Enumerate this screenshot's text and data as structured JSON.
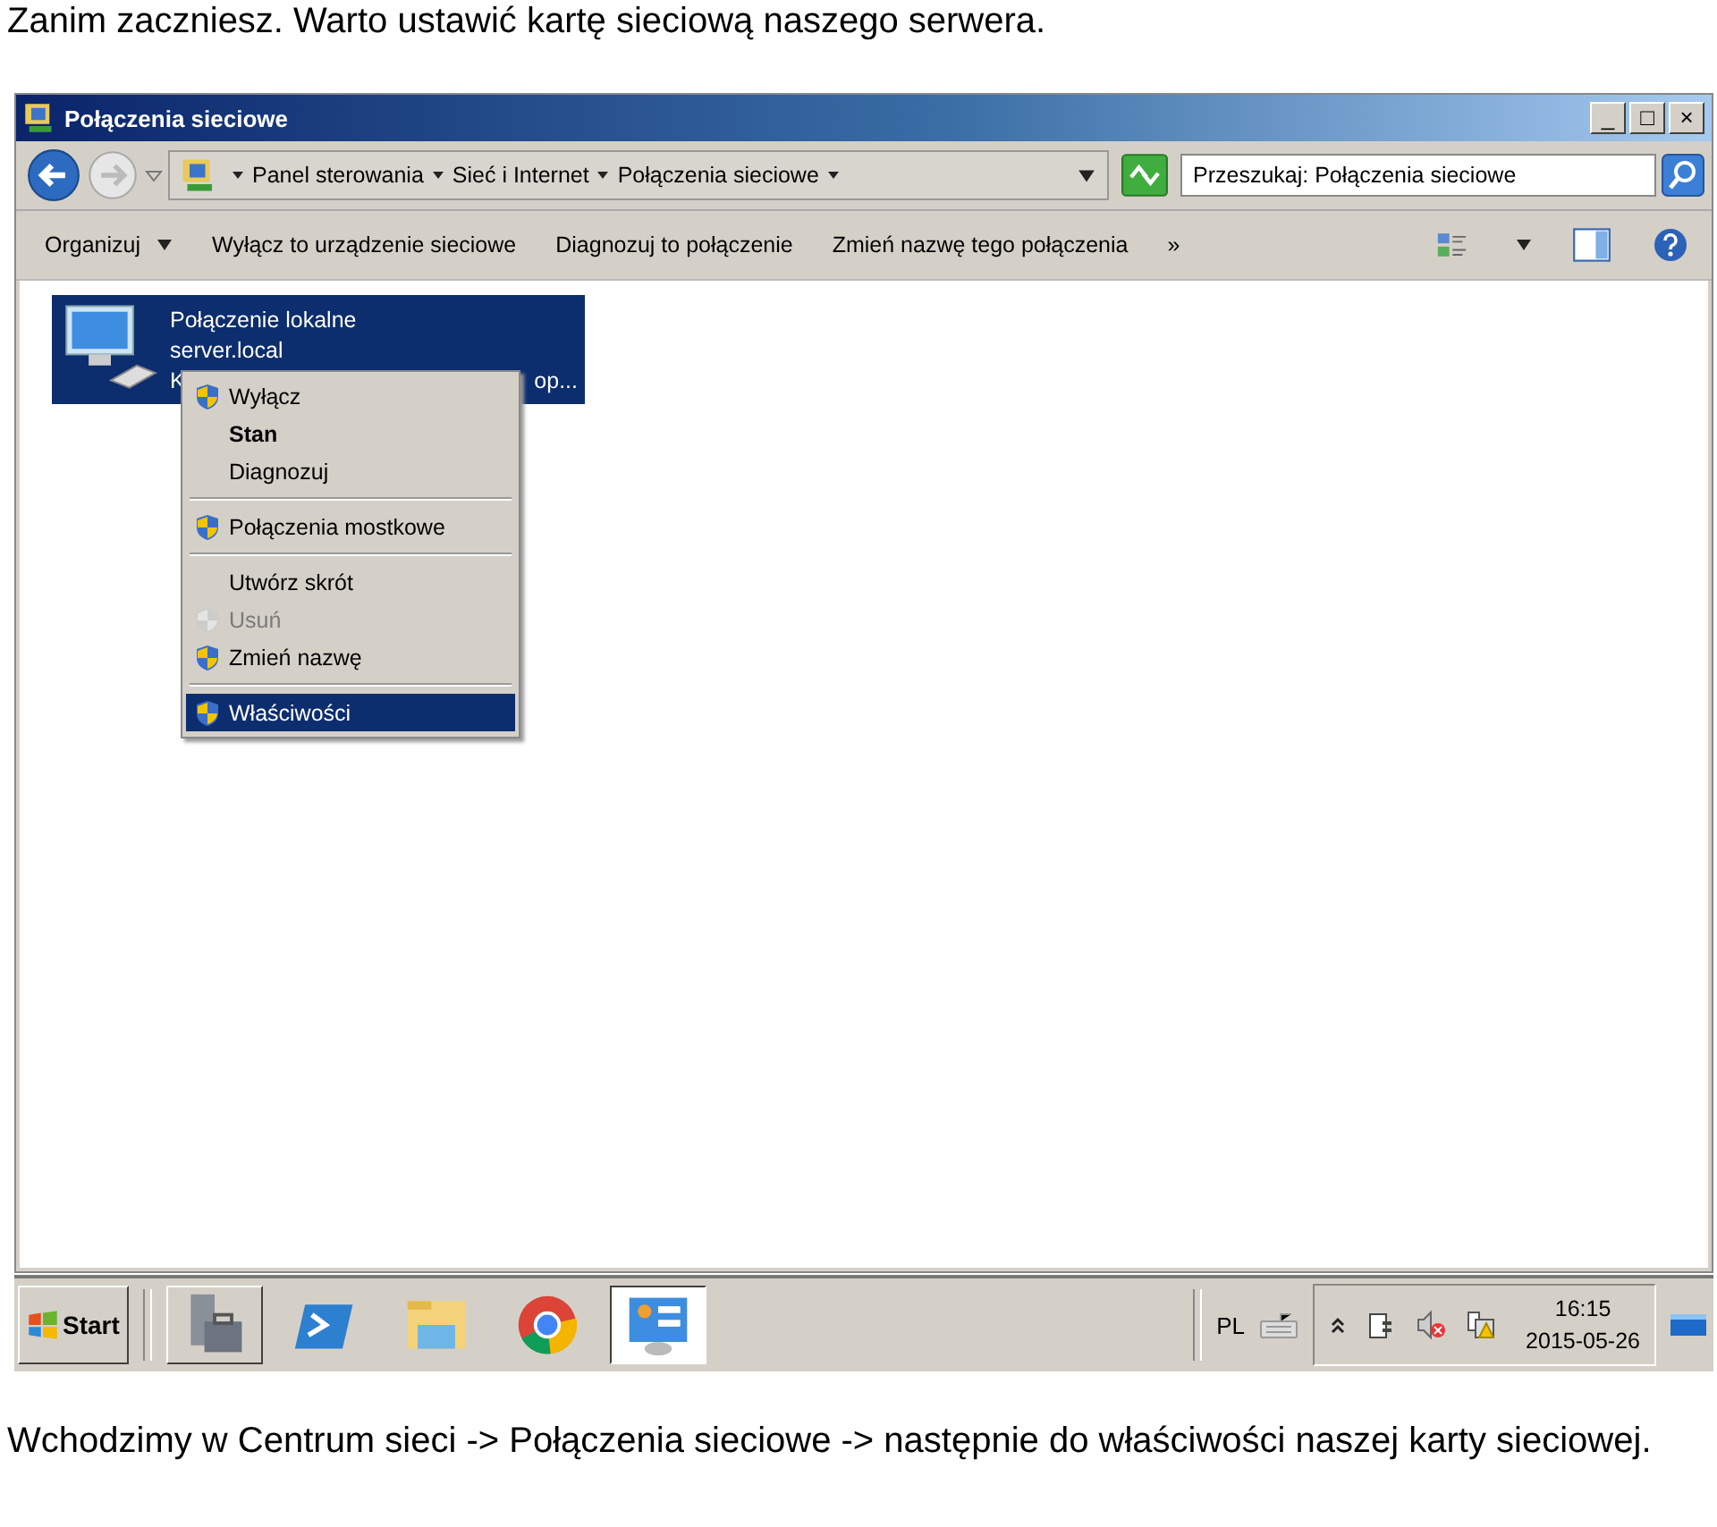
{
  "intro": "Zanim zaczniesz. Warto ustawić kartę sieciową naszego serwera.",
  "window": {
    "title": "Połączenia sieciowe",
    "controls": [
      "_",
      "□",
      "×"
    ]
  },
  "address": {
    "crumbs": [
      "Panel sterowania",
      "Sieć i Internet",
      "Połączenia sieciowe"
    ]
  },
  "search": {
    "placeholder": "Przeszukaj: Połączenia sieciowe"
  },
  "commands": [
    "Organizuj",
    "Wyłącz to urządzenie sieciowe",
    "Diagnozuj to połączenie",
    "Zmień nazwę tego połączenia",
    "»"
  ],
  "connection": {
    "name": "Połączenie lokalne",
    "network": "server.local",
    "line3_start": "K",
    "line3_end": "op...",
    "selected": true
  },
  "context_menu": [
    {
      "kind": "item",
      "label": "Wyłącz",
      "shield": true,
      "bold": false,
      "disabled": false,
      "selected": false
    },
    {
      "kind": "item",
      "label": "Stan",
      "shield": false,
      "bold": true,
      "disabled": false,
      "selected": false
    },
    {
      "kind": "item",
      "label": "Diagnozuj",
      "shield": false,
      "bold": false,
      "disabled": false,
      "selected": false
    },
    {
      "kind": "separator"
    },
    {
      "kind": "item",
      "label": "Połączenia mostkowe",
      "shield": true,
      "bold": false,
      "disabled": false,
      "selected": false
    },
    {
      "kind": "separator"
    },
    {
      "kind": "item",
      "label": "Utwórz skrót",
      "shield": false,
      "bold": false,
      "disabled": false,
      "selected": false
    },
    {
      "kind": "item",
      "label": "Usuń",
      "shield": true,
      "bold": false,
      "disabled": true,
      "selected": false
    },
    {
      "kind": "item",
      "label": "Zmień nazwę",
      "shield": true,
      "bold": false,
      "disabled": false,
      "selected": false
    },
    {
      "kind": "separator"
    },
    {
      "kind": "item",
      "label": "Właściwości",
      "shield": true,
      "bold": false,
      "disabled": false,
      "selected": true
    }
  ],
  "taskbar": {
    "start": "Start",
    "apps": [
      {
        "kind": "server",
        "selected": false
      },
      {
        "kind": "shell",
        "selected": false
      },
      {
        "kind": "folder",
        "selected": false
      },
      {
        "kind": "browser",
        "selected": false
      },
      {
        "kind": "panel",
        "selected": true
      }
    ],
    "language": "PL",
    "time": "16:15",
    "date": "2015-05-26"
  },
  "caption": "Wchodzimy w Centrum sieci -> Połączenia sieciowe -> następnie do właściwości naszej karty sieciowej."
}
